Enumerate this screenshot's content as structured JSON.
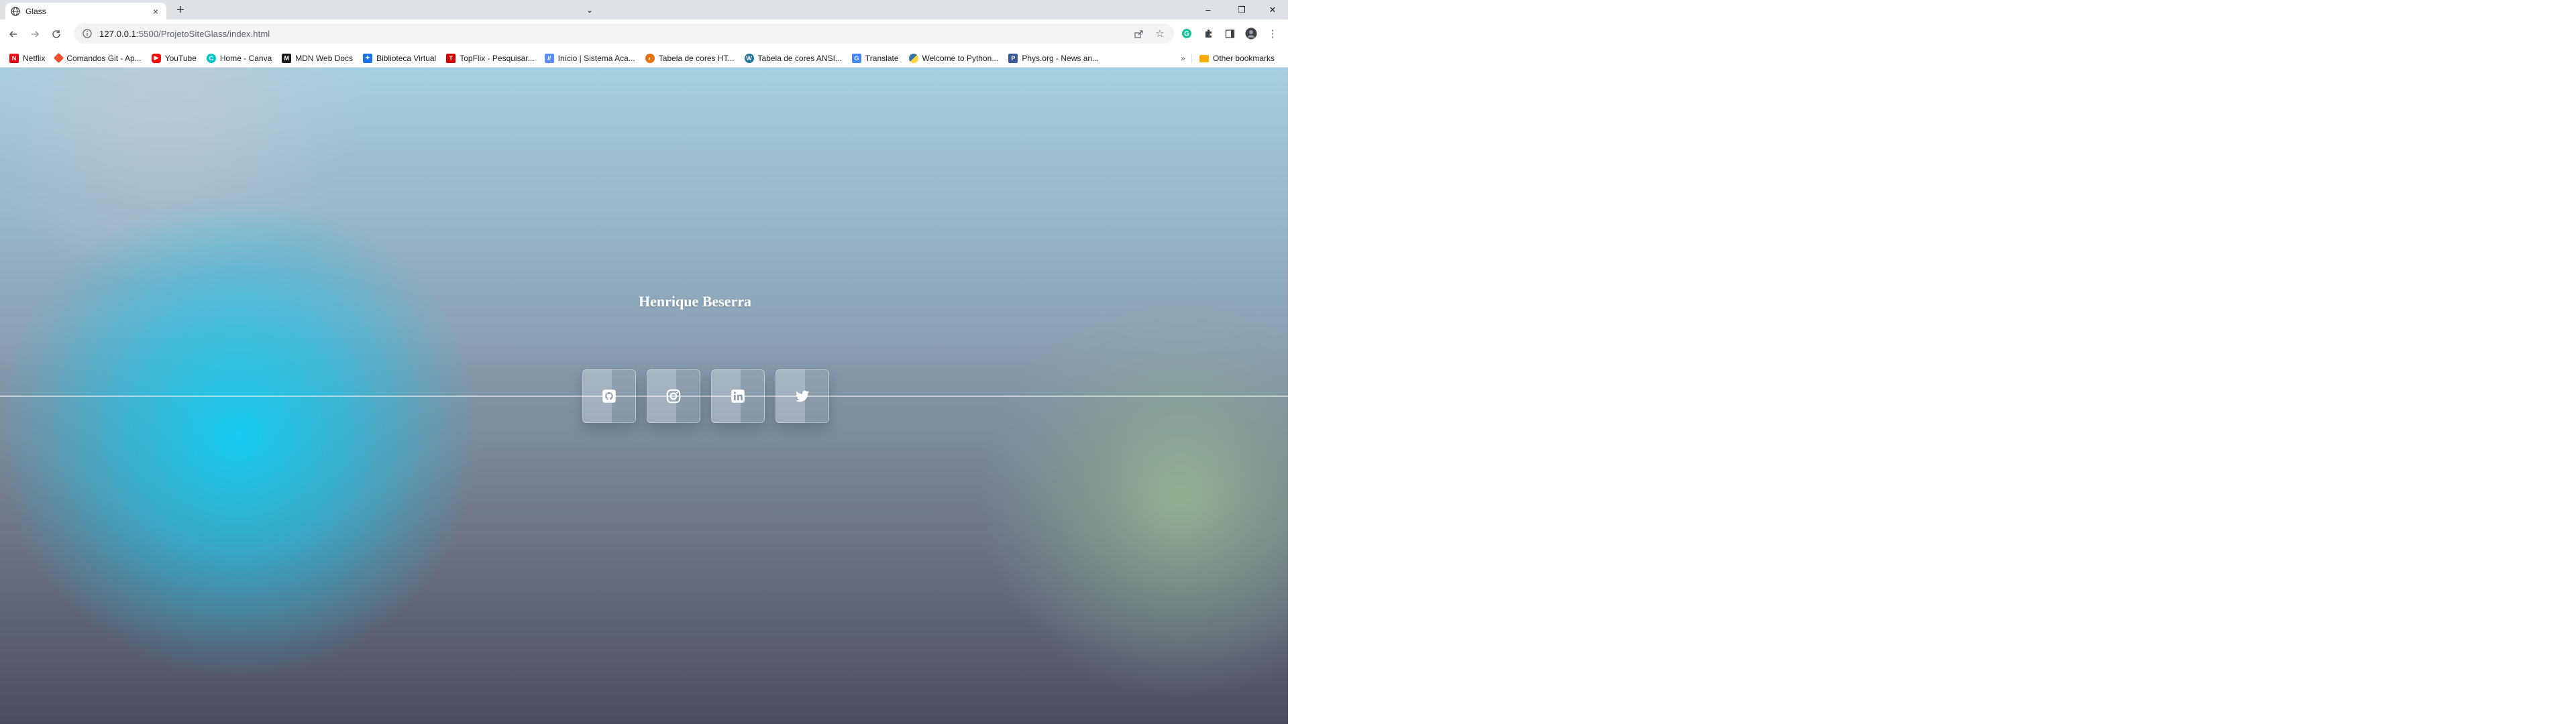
{
  "browser": {
    "tab": {
      "title": "Glass"
    },
    "url": {
      "host": "127.0.0.1",
      "rest": ":5500/ProjetoSiteGlass/index.html"
    },
    "bookmarks": [
      {
        "label": "Netflix",
        "icon": "netflix-icon",
        "color": "#e50914"
      },
      {
        "label": "Comandos Git - Ap...",
        "icon": "git-icon",
        "color": "#f05032"
      },
      {
        "label": "YouTube",
        "icon": "youtube-icon",
        "color": "#ff0000"
      },
      {
        "label": "Home - Canva",
        "icon": "canva-icon",
        "color": "#00c4cc"
      },
      {
        "label": "MDN Web Docs",
        "icon": "mdn-icon",
        "color": "#1b1b1b"
      },
      {
        "label": "Biblioteca Virtual",
        "icon": "biblioteca-icon",
        "color": "#1a73e8"
      },
      {
        "label": "TopFlix - Pesquisar...",
        "icon": "topflix-icon",
        "color": "#d50000"
      },
      {
        "label": "Início | Sistema Aca...",
        "icon": "sistema-icon",
        "color": "#5b8def"
      },
      {
        "label": "Tabela de cores HT...",
        "icon": "tabela-html-icon",
        "color": "#e8710a"
      },
      {
        "label": "Tabela de cores ANSI...",
        "icon": "wordpress-icon",
        "color": "#21759b"
      },
      {
        "label": "Translate",
        "icon": "translate-icon",
        "color": "#4285f4"
      },
      {
        "label": "Welcome to Python...",
        "icon": "python-icon",
        "color": "#3776ab"
      },
      {
        "label": "Phys.org - News an...",
        "icon": "physorg-icon",
        "color": "#3c5a99"
      }
    ],
    "more_label": "»",
    "other_bookmarks": "Other bookmarks"
  },
  "page": {
    "name": "Henrique Beserra",
    "socials": [
      {
        "id": "github",
        "icon": "github-icon"
      },
      {
        "id": "instagram",
        "icon": "instagram-icon"
      },
      {
        "id": "linkedin",
        "icon": "linkedin-icon"
      },
      {
        "id": "twitter",
        "icon": "twitter-icon"
      }
    ]
  }
}
